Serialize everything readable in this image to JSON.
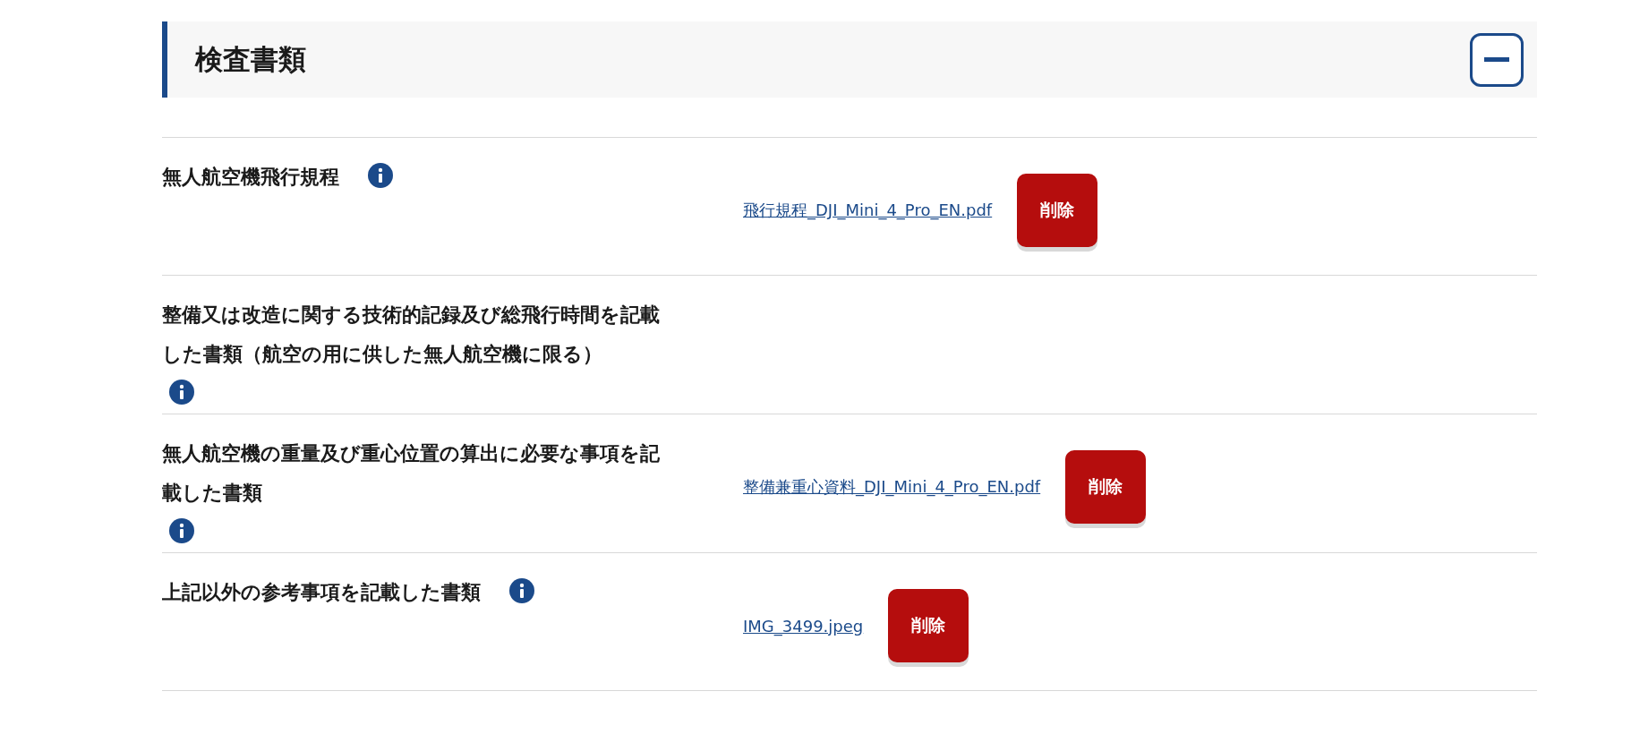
{
  "section": {
    "title": "検査書類",
    "expanded": true
  },
  "documents": [
    {
      "label": "無人航空機飛行規程",
      "file": {
        "name": "飛行規程_DJI_Mini_4_Pro_EN.pdf",
        "action": "削除"
      }
    },
    {
      "label": "整備又は改造に関する技術的記録及び総飛行時間を記載した書類（航空の用に供した無人航空機に限る）"
    },
    {
      "label": "無人航空機の重量及び重心位置の算出に必要な事項を記載した書類",
      "file": {
        "name": "整備兼重心資料_DJI_Mini_4_Pro_EN.pdf",
        "action": "削除"
      }
    },
    {
      "label": "上記以外の参考事項を記載した書類",
      "file": {
        "name": "IMG_3499.jpeg",
        "action": "削除"
      }
    }
  ]
}
